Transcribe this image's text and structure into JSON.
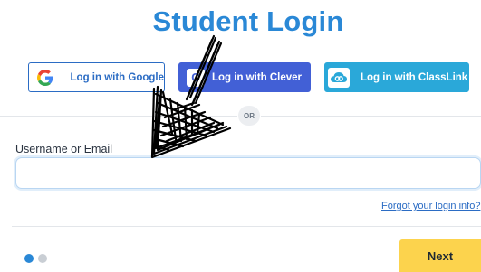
{
  "page": {
    "title": "Student Login"
  },
  "sso": {
    "google_label": "Log in with Google",
    "clever_label": "Log in with Clever",
    "clever_icon_glyph": "C",
    "classlink_label": "Log in with ClassLink"
  },
  "divider": {
    "or_label": "OR"
  },
  "form": {
    "username_label": "Username or Email",
    "username_value": "",
    "username_placeholder": "",
    "forgot_link": "Forgot your login info?"
  },
  "footer": {
    "next_label": "Next",
    "step_dots": [
      {
        "state": "active"
      },
      {
        "state": "inactive"
      }
    ]
  },
  "colors": {
    "title_blue": "#2a88d6",
    "google_border": "#2b6cc4",
    "clever_bg": "#4260d6",
    "classlink_bg": "#2aa8d9",
    "next_bg": "#fcd34d",
    "scribble": "#000000"
  },
  "icons": {
    "google": "google-icon",
    "clever": "clever-icon",
    "classlink": "classlink-icon",
    "annotation": "hand-drawn-arrow-scribble"
  }
}
